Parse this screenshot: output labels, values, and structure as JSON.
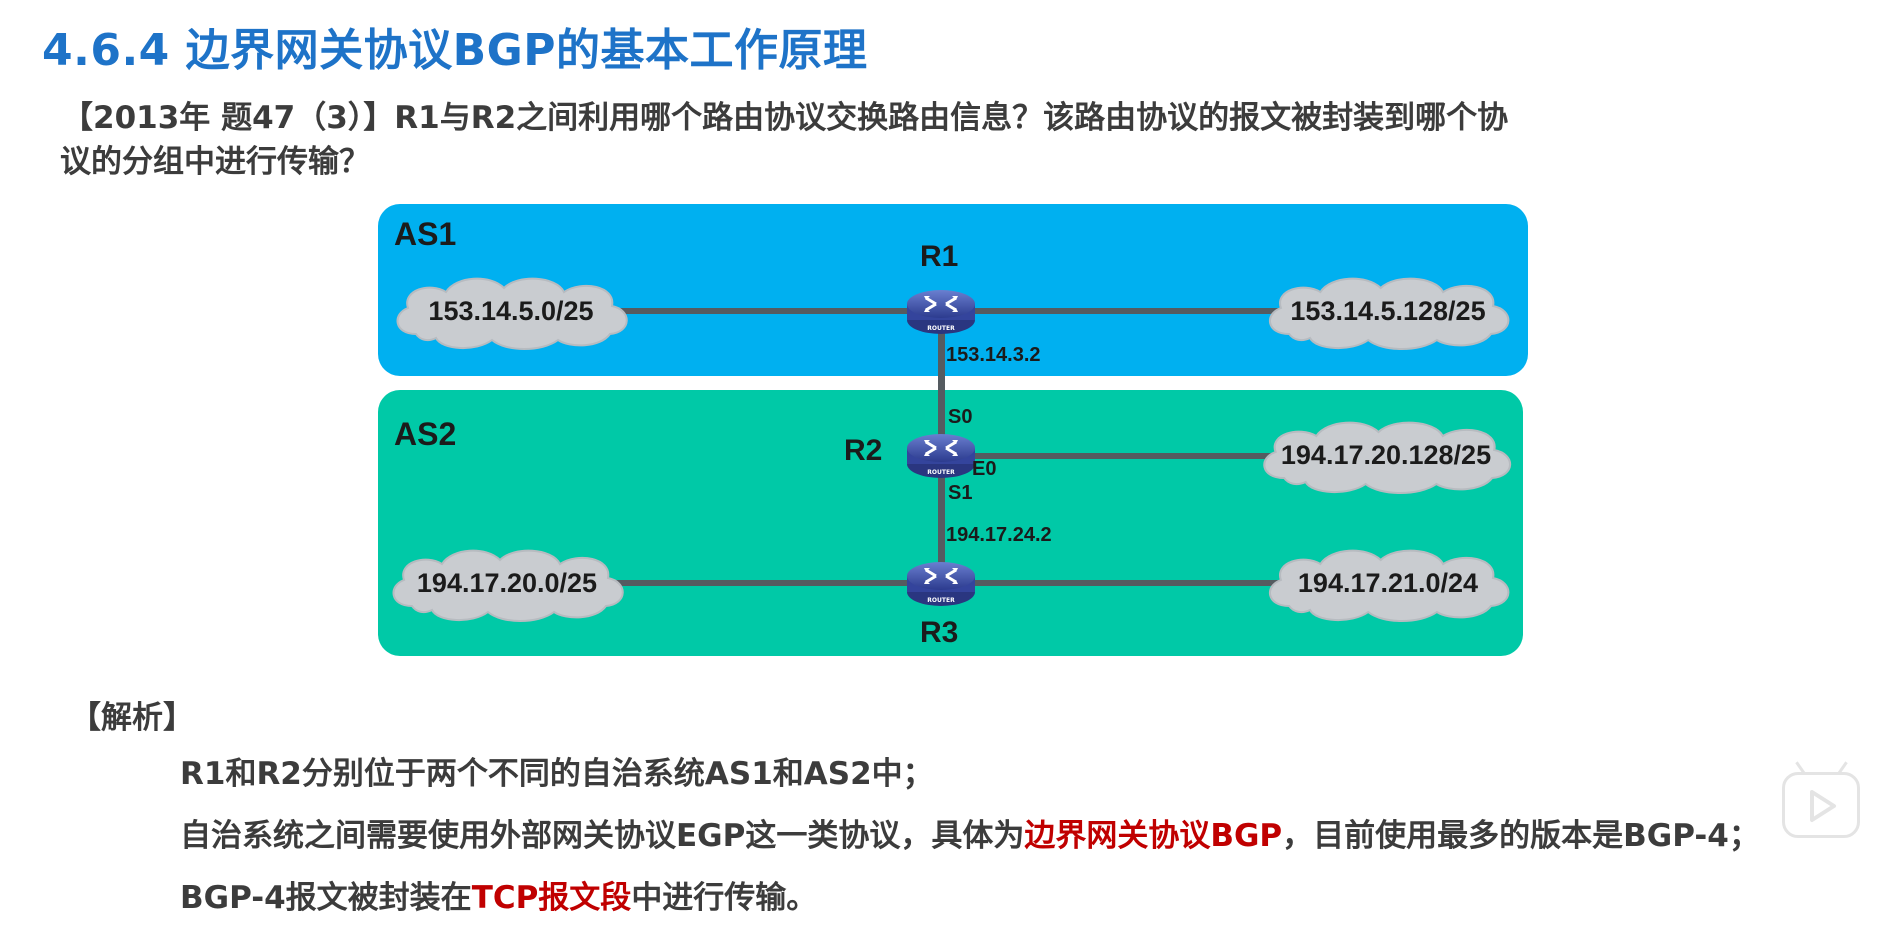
{
  "header": {
    "title": "4.6.4 边界网关协议BGP的基本工作原理"
  },
  "question": {
    "line1": "【2013年 题47（3）】R1与R2之间利用哪个路由协议交换路由信息？该路由协议的报文被封装到哪个协",
    "line2": "议的分组中进行传输？"
  },
  "diagram": {
    "as1_label": "AS1",
    "as2_label": "AS2",
    "routers": {
      "r1": "R1",
      "r2": "R2",
      "r3": "R3",
      "icon_text": "ROUTER"
    },
    "clouds": {
      "as1_left": "153.14.5.0/25",
      "as1_right": "153.14.5.128/25",
      "as2_right_top": "194.17.20.128/25",
      "as2_left_bottom": "194.17.20.0/25",
      "as2_right_bottom": "194.17.21.0/24"
    },
    "interfaces": {
      "r1_ip": "153.14.3.2",
      "r2_s0": "S0",
      "r2_e0": "E0",
      "r2_s1": "S1",
      "r3_ip": "194.17.24.2"
    },
    "colors": {
      "as1_bg": "#00b0f0",
      "as2_bg": "#00c9a7",
      "cloud": "#c9ccd0",
      "link": "#555b60"
    }
  },
  "analysis": {
    "heading": "【解析】",
    "line1": "R1和R2分别位于两个不同的自治系统AS1和AS2中；",
    "line2_pre": "自治系统之间需要使用外部网关协议EGP这一类协议，具体为",
    "line2_hl": "边界网关协议BGP",
    "line2_post": "，目前使用最多的版本是BGP-4；",
    "line3_pre": "BGP-4报文被封装在",
    "line3_hl": "TCP报文段",
    "line3_post": "中进行传输。",
    "highlight_color": "#c00000"
  },
  "overlay": {
    "play_icon": "play-icon"
  }
}
